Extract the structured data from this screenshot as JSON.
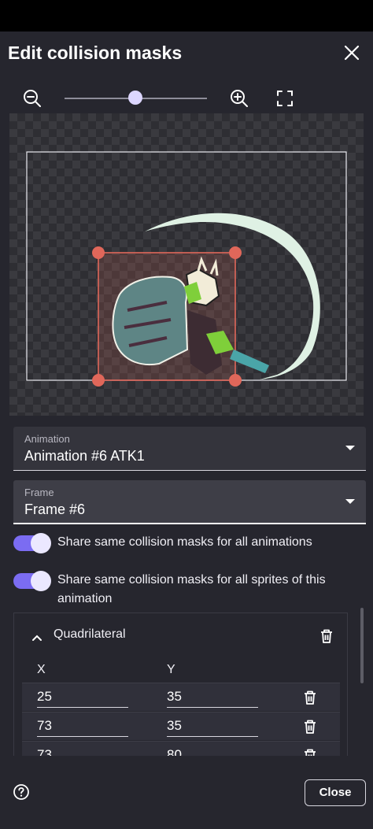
{
  "dialog": {
    "title": "Edit collision masks"
  },
  "toolbar": {
    "zoom_level": 0.5
  },
  "fields": {
    "animation": {
      "label": "Animation",
      "value": "Animation #6 ATK1"
    },
    "frame": {
      "label": "Frame",
      "value": "Frame #6"
    }
  },
  "toggles": [
    {
      "label": "Share same collision masks for all animations",
      "on": true
    },
    {
      "label": "Share same collision masks for all sprites of this animation",
      "on": true
    }
  ],
  "mask": {
    "shape": "Quadrilateral",
    "col_x": "X",
    "col_y": "Y",
    "points": [
      {
        "x": "25",
        "y": "35"
      },
      {
        "x": "73",
        "y": "35"
      },
      {
        "x": "73",
        "y": "80"
      }
    ]
  },
  "footer": {
    "close_label": "Close"
  },
  "colors": {
    "accent": "#7b6cf2",
    "handle": "#e0675a",
    "background": "#26262e"
  }
}
